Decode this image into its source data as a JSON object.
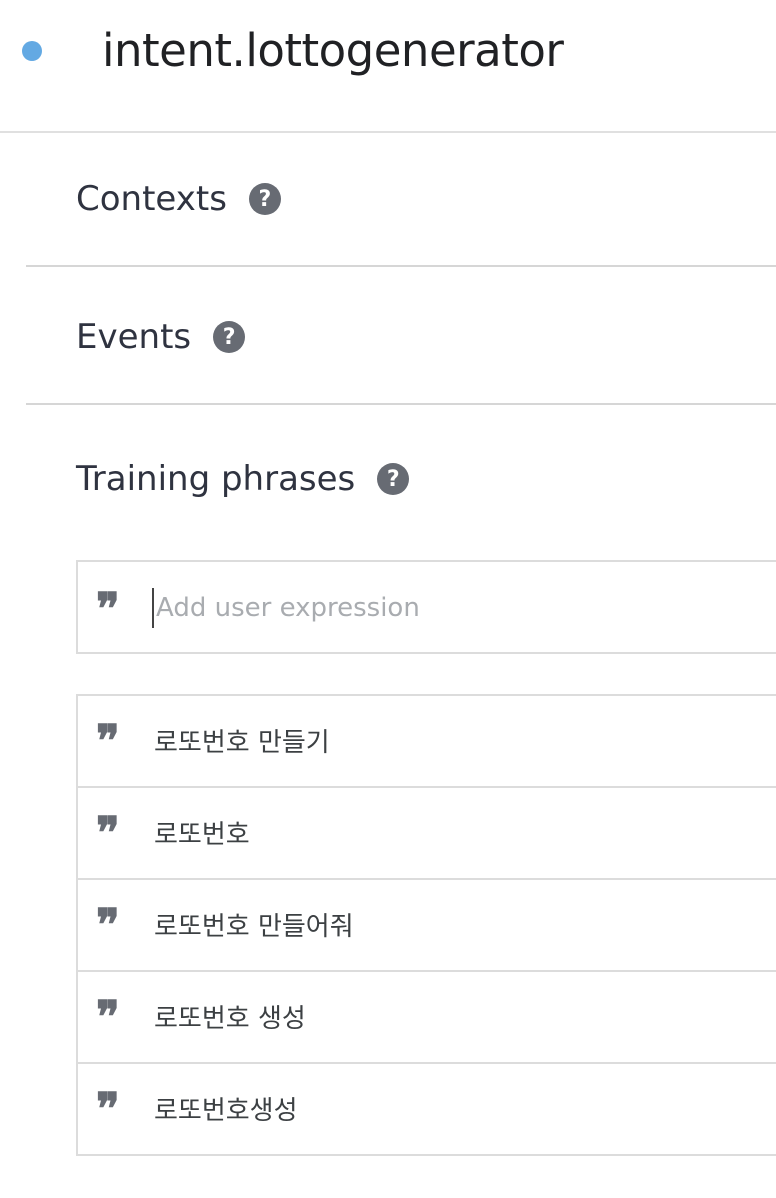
{
  "header": {
    "intent_name": "intent.lottogenerator",
    "status_dot_color": "#63a9e3"
  },
  "sections": {
    "contexts_label": "Contexts",
    "events_label": "Events",
    "training_phrases_label": "Training phrases",
    "help_icon_glyph": "?"
  },
  "training_phrases": {
    "input_placeholder": "Add user expression",
    "input_value": "",
    "quote_icon_glyph": "❞",
    "items": [
      {
        "text": "로또번호 만들기"
      },
      {
        "text": "로또번호"
      },
      {
        "text": "로또번호 만들어줘"
      },
      {
        "text": "로또번호 생성"
      },
      {
        "text": "로또번호생성"
      }
    ]
  }
}
